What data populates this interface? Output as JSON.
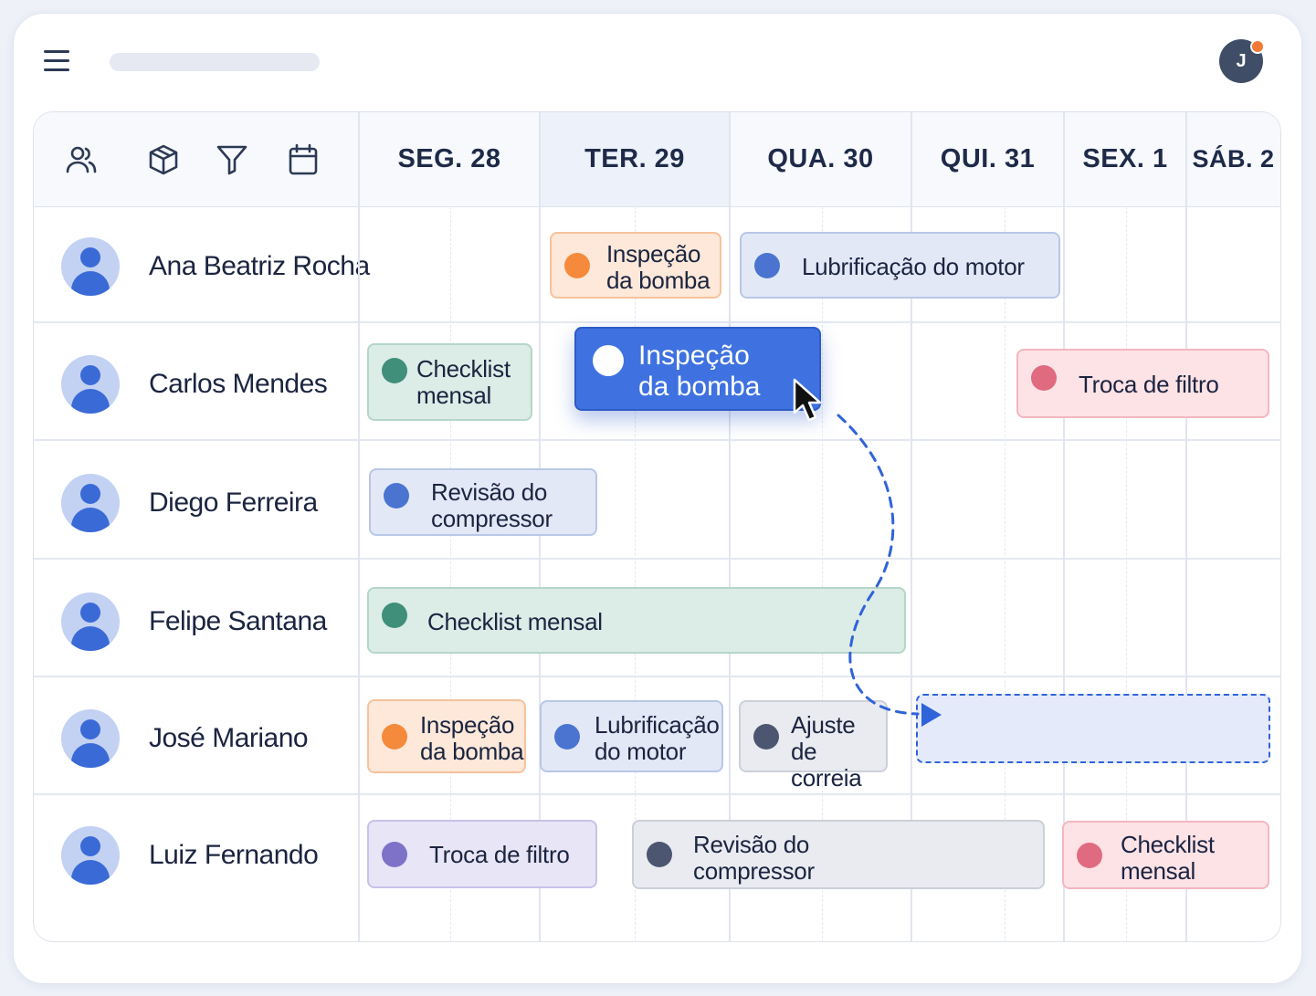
{
  "header": {
    "menu_icon": "hamburger-menu-icon",
    "user_avatar_initial": "J",
    "notification_color": "#f27a35"
  },
  "toolbar": {
    "icons": [
      "users-icon",
      "box-icon",
      "filter-icon",
      "calendar-icon"
    ]
  },
  "days": [
    {
      "label": "SEG. 28"
    },
    {
      "label": "TER. 29",
      "today": true
    },
    {
      "label": "QUA. 30"
    },
    {
      "label": "QUI. 31"
    },
    {
      "label": "SEX. 1"
    },
    {
      "label": "SÁB. 2"
    }
  ],
  "people": [
    {
      "name": "Ana Beatriz Rocha"
    },
    {
      "name": "Carlos Mendes"
    },
    {
      "name": "Diego Ferreira"
    },
    {
      "name": "Felipe Santana"
    },
    {
      "name": "José Mariano"
    },
    {
      "name": "Luiz Fernando"
    }
  ],
  "tasks": {
    "ana_1": {
      "label": "Inspeção\nda bomba",
      "color": "#f58a3c"
    },
    "ana_2": {
      "label": "Lubrificação do motor",
      "color": "#4a74d0"
    },
    "carlos_1": {
      "label": "Checklist\nmensal",
      "color": "#3f8f7a"
    },
    "carlos_2": {
      "label": "Troca de filtro",
      "color": "#e06b80"
    },
    "diego_1": {
      "label": "Revisão do\ncompressor",
      "color": "#4a74d0"
    },
    "felipe_1": {
      "label": "Checklist mensal",
      "color": "#3f8f7a"
    },
    "jose_1": {
      "label": "Inspeção\nda bomba",
      "color": "#f58a3c"
    },
    "jose_2": {
      "label": "Lubrificação\ndo motor",
      "color": "#4a74d0"
    },
    "jose_3": {
      "label": "Ajuste\nde correia",
      "color": "#4c5670"
    },
    "luiz_1": {
      "label": "Troca de filtro",
      "color": "#7d72c8"
    },
    "luiz_2": {
      "label": "Revisão do\ncompressor",
      "color": "#4c5670"
    },
    "luiz_3": {
      "label": "Checklist\nmensal",
      "color": "#e06b80"
    }
  },
  "dragging_task": {
    "label": "Inspeção\nda bomba",
    "color": "#3f72e0"
  }
}
